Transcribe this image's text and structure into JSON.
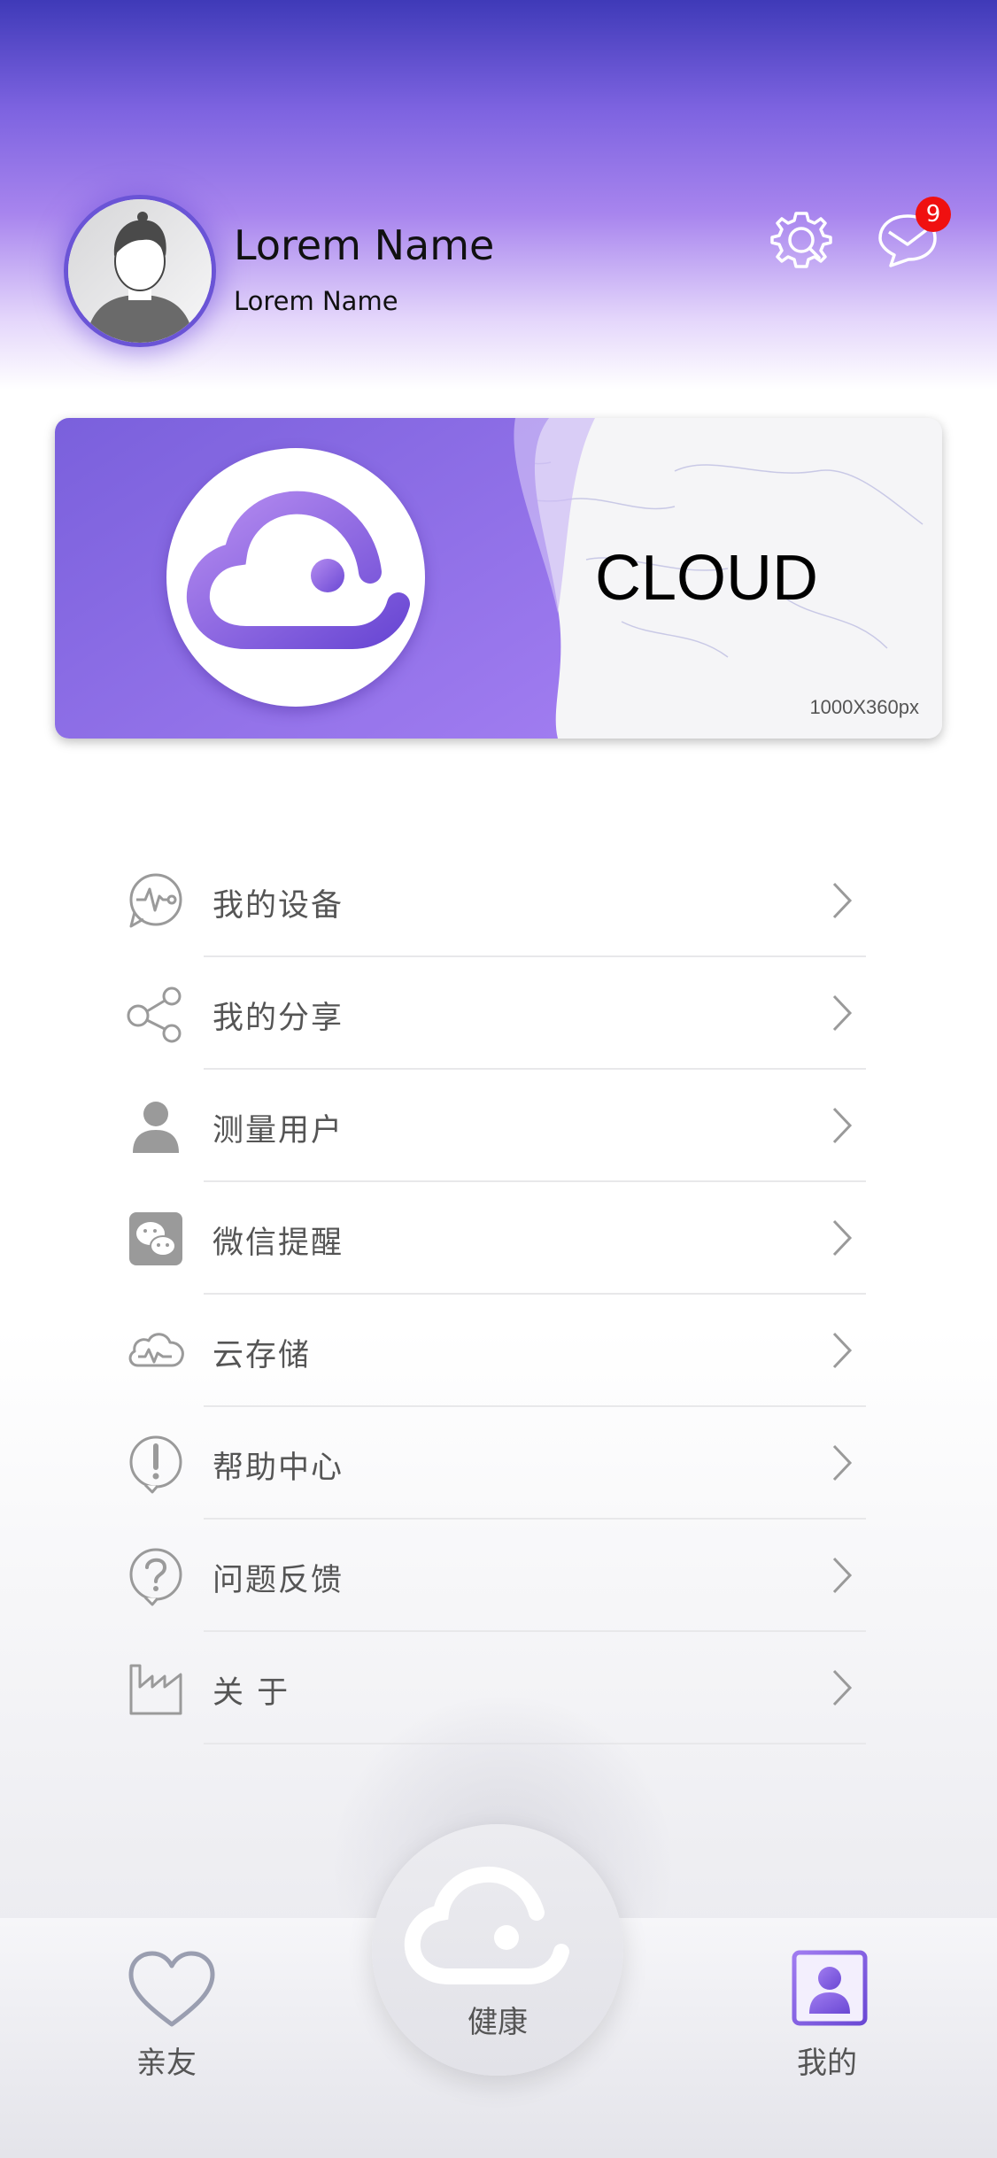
{
  "profile": {
    "name": "Lorem Name",
    "subtitle": "Lorem Name",
    "unread_count": "9"
  },
  "banner": {
    "title": "CLOUD",
    "size_label": "1000X360px"
  },
  "menu": {
    "items": [
      {
        "label": "我的设备",
        "icon": "device-pulse-icon"
      },
      {
        "label": "我的分享",
        "icon": "share-icon"
      },
      {
        "label": "测量用户",
        "icon": "user-icon"
      },
      {
        "label": "微信提醒",
        "icon": "wechat-icon"
      },
      {
        "label": "云存储",
        "icon": "cloud-storage-icon"
      },
      {
        "label": "帮助中心",
        "icon": "help-exclamation-icon"
      },
      {
        "label": "问题反馈",
        "icon": "feedback-question-icon"
      },
      {
        "label": "关 于",
        "icon": "about-factory-icon"
      }
    ]
  },
  "tabbar": {
    "left_label": "亲友",
    "center_label": "健康",
    "right_label": "我的"
  },
  "colors": {
    "brand": "#7d5ae0",
    "badge": "#f01010",
    "text": "#555555"
  }
}
